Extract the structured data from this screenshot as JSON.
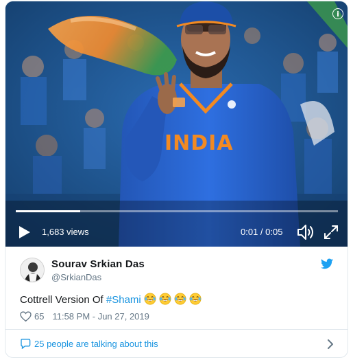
{
  "video": {
    "views": "1,683 views",
    "time": "0:01 / 0:05",
    "progress": 0.2,
    "info_glyph": "i",
    "icons": [
      "info-icon",
      "play-icon",
      "volume-icon",
      "fullscreen-icon"
    ]
  },
  "tweet": {
    "author_name": "Sourav Srkian Das",
    "author_handle": "@SrkianDas",
    "text_prefix": "Cottrell Version Of ",
    "hashtag": "#Shami",
    "emoji_count": 4,
    "likes": "65",
    "timestamp": "11:58 PM - Jun 27, 2019",
    "talking": "25 people are talking about this",
    "icons": [
      "twitter-bird-icon",
      "heart-icon",
      "chat-bubble-icon",
      "chevron-right-icon"
    ]
  },
  "colors": {
    "link": "#1b95e0",
    "secondary_text": "#657786",
    "border": "#e1e8ed",
    "jersey_blue": "#1f63c8",
    "jersey_orange": "#f28a22"
  }
}
